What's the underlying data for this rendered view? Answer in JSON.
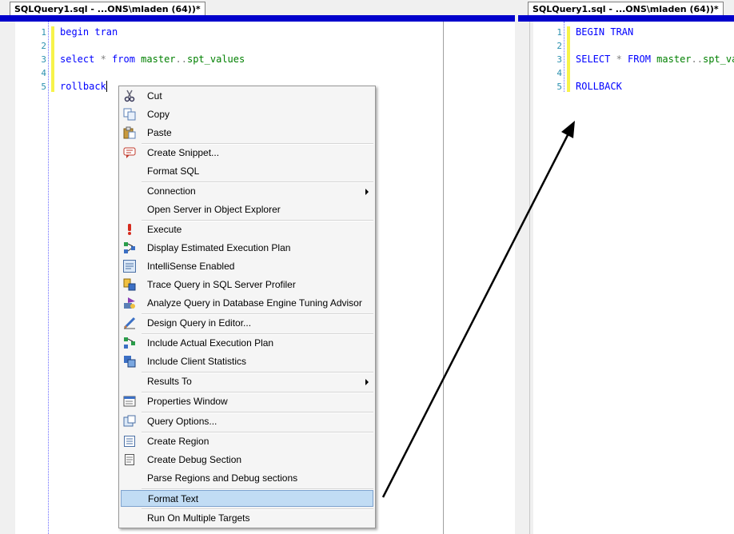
{
  "left_pane": {
    "tab_title": "SQLQuery1.sql - ...ONS\\mladen (64))*",
    "lines": [
      {
        "num": "1",
        "tokens": [
          {
            "t": "begin tran",
            "c": "kw"
          }
        ]
      },
      {
        "num": "2",
        "tokens": []
      },
      {
        "num": "3",
        "tokens": [
          {
            "t": "select",
            "c": "kw"
          },
          {
            "t": " * ",
            "c": "op"
          },
          {
            "t": "from",
            "c": "kw"
          },
          {
            "t": " master",
            "c": "obj"
          },
          {
            "t": "..",
            "c": "op"
          },
          {
            "t": "spt_values",
            "c": "obj"
          }
        ]
      },
      {
        "num": "4",
        "tokens": []
      },
      {
        "num": "5",
        "tokens": [
          {
            "t": "rollback",
            "c": "kw"
          }
        ]
      }
    ]
  },
  "right_pane": {
    "tab_title": "SQLQuery1.sql - ...ONS\\mladen (64))*",
    "lines": [
      {
        "num": "1",
        "tokens": [
          {
            "t": "BEGIN TRAN",
            "c": "kw"
          }
        ]
      },
      {
        "num": "2",
        "tokens": []
      },
      {
        "num": "3",
        "tokens": [
          {
            "t": "SELECT",
            "c": "kw"
          },
          {
            "t": " * ",
            "c": "op"
          },
          {
            "t": "FROM",
            "c": "kw"
          },
          {
            "t": " master",
            "c": "obj"
          },
          {
            "t": "..",
            "c": "op"
          },
          {
            "t": "spt_values",
            "c": "obj"
          }
        ]
      },
      {
        "num": "4",
        "tokens": []
      },
      {
        "num": "5",
        "tokens": [
          {
            "t": "ROLLBACK",
            "c": "kw"
          }
        ]
      }
    ]
  },
  "context_menu": {
    "items": [
      {
        "label": "Cut",
        "icon": "scissors-icon"
      },
      {
        "label": "Copy",
        "icon": "copy-icon"
      },
      {
        "label": "Paste",
        "icon": "paste-icon"
      },
      {
        "label": "Create Snippet...",
        "icon": "snippet-icon"
      },
      {
        "label": "Format SQL",
        "icon": ""
      },
      {
        "label": "Connection",
        "icon": "",
        "submenu": true
      },
      {
        "label": "Open Server in Object Explorer",
        "icon": ""
      },
      {
        "label": "Execute",
        "icon": "execute-icon"
      },
      {
        "label": "Display Estimated Execution Plan",
        "icon": "execution-plan-icon"
      },
      {
        "label": "IntelliSense Enabled",
        "icon": "intellisense-icon"
      },
      {
        "label": "Trace Query in SQL Server Profiler",
        "icon": "profiler-icon"
      },
      {
        "label": "Analyze Query in Database Engine Tuning Advisor",
        "icon": "tuning-advisor-icon"
      },
      {
        "label": "Design Query in Editor...",
        "icon": "design-query-icon"
      },
      {
        "label": "Include Actual Execution Plan",
        "icon": "actual-plan-icon"
      },
      {
        "label": "Include Client Statistics",
        "icon": "client-statistics-icon"
      },
      {
        "label": "Results To",
        "icon": "",
        "submenu": true
      },
      {
        "label": "Properties Window",
        "icon": "properties-icon"
      },
      {
        "label": "Query Options...",
        "icon": "query-options-icon"
      },
      {
        "label": "Create Region",
        "icon": "region-icon"
      },
      {
        "label": "Create Debug Section",
        "icon": "debug-section-icon"
      },
      {
        "label": "Parse Regions and Debug sections",
        "icon": ""
      },
      {
        "label": "Format Text",
        "icon": "",
        "highlighted": true
      },
      {
        "label": "Run On Multiple Targets",
        "icon": ""
      }
    ]
  },
  "colors": {
    "tab_underline": "#0000cc",
    "keyword": "#0000ff",
    "operator": "#808080",
    "object_name": "#008000",
    "line_number": "#2b91af",
    "change_bar": "#f7f34a",
    "menu_highlight": "#c1dcf4"
  }
}
